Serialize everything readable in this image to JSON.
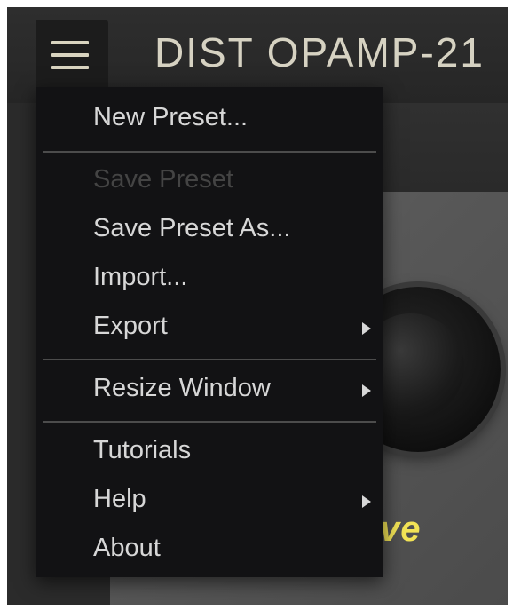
{
  "header": {
    "title": "DIST OPAMP-21",
    "menu_icon": "hamburger-menu-icon"
  },
  "plugin": {
    "knob_label_visible": "ve",
    "accent_color": "#f2e356"
  },
  "menu": {
    "items": [
      {
        "label": "New Preset...",
        "enabled": true,
        "submenu": false
      },
      {
        "label": "Save Preset",
        "enabled": false,
        "submenu": false
      },
      {
        "label": "Save Preset As...",
        "enabled": true,
        "submenu": false
      },
      {
        "label": "Import...",
        "enabled": true,
        "submenu": false
      },
      {
        "label": "Export",
        "enabled": true,
        "submenu": true
      },
      {
        "label": "Resize Window",
        "enabled": true,
        "submenu": true
      },
      {
        "label": "Tutorials",
        "enabled": true,
        "submenu": false
      },
      {
        "label": "Help",
        "enabled": true,
        "submenu": true
      },
      {
        "label": "About",
        "enabled": true,
        "submenu": false
      }
    ]
  }
}
